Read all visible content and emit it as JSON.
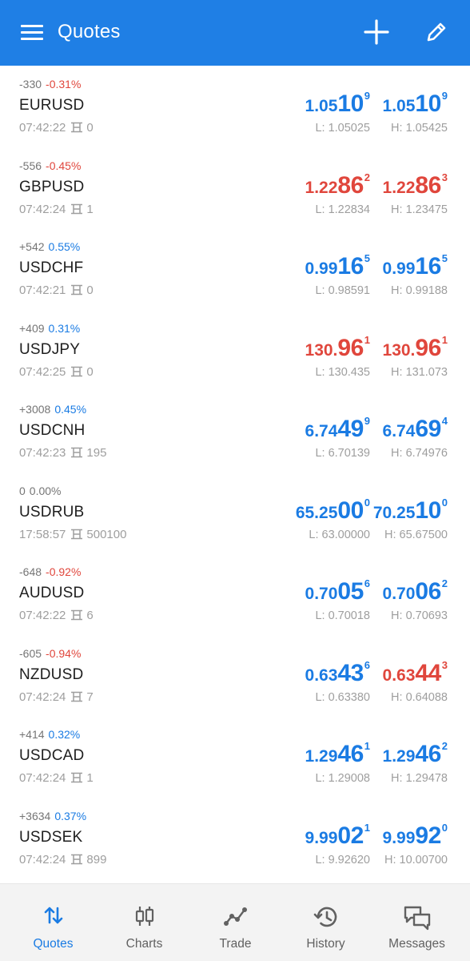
{
  "header": {
    "title": "Quotes"
  },
  "quotes": [
    {
      "symbol": "EURUSD",
      "change_points": "-330",
      "change_pct": "-0.31%",
      "pct_color": "red",
      "time": "07:42:22",
      "spread": "0",
      "bid": {
        "small": "1.05",
        "big": "10",
        "sup": "9",
        "color": "blue"
      },
      "ask": {
        "small": "1.05",
        "big": "10",
        "sup": "9",
        "color": "blue"
      },
      "low": "L: 1.05025",
      "high": "H: 1.05425"
    },
    {
      "symbol": "GBPUSD",
      "change_points": "-556",
      "change_pct": "-0.45%",
      "pct_color": "red",
      "time": "07:42:24",
      "spread": "1",
      "bid": {
        "small": "1.22",
        "big": "86",
        "sup": "2",
        "color": "red"
      },
      "ask": {
        "small": "1.22",
        "big": "86",
        "sup": "3",
        "color": "red"
      },
      "low": "L: 1.22834",
      "high": "H: 1.23475"
    },
    {
      "symbol": "USDCHF",
      "change_points": "+542",
      "change_pct": "0.55%",
      "pct_color": "blue",
      "time": "07:42:21",
      "spread": "0",
      "bid": {
        "small": "0.99",
        "big": "16",
        "sup": "5",
        "color": "blue"
      },
      "ask": {
        "small": "0.99",
        "big": "16",
        "sup": "5",
        "color": "blue"
      },
      "low": "L: 0.98591",
      "high": "H: 0.99188"
    },
    {
      "symbol": "USDJPY",
      "change_points": "+409",
      "change_pct": "0.31%",
      "pct_color": "blue",
      "time": "07:42:25",
      "spread": "0",
      "bid": {
        "small": "130.",
        "big": "96",
        "sup": "1",
        "color": "red"
      },
      "ask": {
        "small": "130.",
        "big": "96",
        "sup": "1",
        "color": "red"
      },
      "low": "L: 130.435",
      "high": "H: 131.073"
    },
    {
      "symbol": "USDCNH",
      "change_points": "+3008",
      "change_pct": "0.45%",
      "pct_color": "blue",
      "time": "07:42:23",
      "spread": "195",
      "bid": {
        "small": "6.74",
        "big": "49",
        "sup": "9",
        "color": "blue"
      },
      "ask": {
        "small": "6.74",
        "big": "69",
        "sup": "4",
        "color": "blue"
      },
      "low": "L: 6.70139",
      "high": "H: 6.74976"
    },
    {
      "symbol": "USDRUB",
      "change_points": "0",
      "change_pct": "0.00%",
      "pct_color": "grey",
      "time": "17:58:57",
      "spread": "500100",
      "bid": {
        "small": "65.25",
        "big": "00",
        "sup": "0",
        "color": "blue"
      },
      "ask": {
        "small": "70.25",
        "big": "10",
        "sup": "0",
        "color": "blue"
      },
      "low": "L: 63.00000",
      "high": "H: 65.67500"
    },
    {
      "symbol": "AUDUSD",
      "change_points": "-648",
      "change_pct": "-0.92%",
      "pct_color": "red",
      "time": "07:42:22",
      "spread": "6",
      "bid": {
        "small": "0.70",
        "big": "05",
        "sup": "6",
        "color": "blue"
      },
      "ask": {
        "small": "0.70",
        "big": "06",
        "sup": "2",
        "color": "blue"
      },
      "low": "L: 0.70018",
      "high": "H: 0.70693"
    },
    {
      "symbol": "NZDUSD",
      "change_points": "-605",
      "change_pct": "-0.94%",
      "pct_color": "red",
      "time": "07:42:24",
      "spread": "7",
      "bid": {
        "small": "0.63",
        "big": "43",
        "sup": "6",
        "color": "blue"
      },
      "ask": {
        "small": "0.63",
        "big": "44",
        "sup": "3",
        "color": "red"
      },
      "low": "L: 0.63380",
      "high": "H: 0.64088"
    },
    {
      "symbol": "USDCAD",
      "change_points": "+414",
      "change_pct": "0.32%",
      "pct_color": "blue",
      "time": "07:42:24",
      "spread": "1",
      "bid": {
        "small": "1.29",
        "big": "46",
        "sup": "1",
        "color": "blue"
      },
      "ask": {
        "small": "1.29",
        "big": "46",
        "sup": "2",
        "color": "blue"
      },
      "low": "L: 1.29008",
      "high": "H: 1.29478"
    },
    {
      "symbol": "USDSEK",
      "change_points": "+3634",
      "change_pct": "0.37%",
      "pct_color": "blue",
      "time": "07:42:24",
      "spread": "899",
      "bid": {
        "small": "9.99",
        "big": "02",
        "sup": "1",
        "color": "blue"
      },
      "ask": {
        "small": "9.99",
        "big": "92",
        "sup": "0",
        "color": "blue"
      },
      "low": "L: 9.92620",
      "high": "H: 10.00700"
    }
  ],
  "bottom_nav": {
    "items": [
      {
        "label": "Quotes",
        "icon": "quotes-arrows-icon",
        "active": true
      },
      {
        "label": "Charts",
        "icon": "candlestick-icon",
        "active": false
      },
      {
        "label": "Trade",
        "icon": "trend-line-icon",
        "active": false
      },
      {
        "label": "History",
        "icon": "history-clock-icon",
        "active": false
      },
      {
        "label": "Messages",
        "icon": "chat-bubbles-icon",
        "active": false
      }
    ]
  },
  "colors": {
    "appbar": "#1f7fe5",
    "up_blue": "#1a7be3",
    "down_red": "#e0463c",
    "muted": "#9e9e9e"
  }
}
